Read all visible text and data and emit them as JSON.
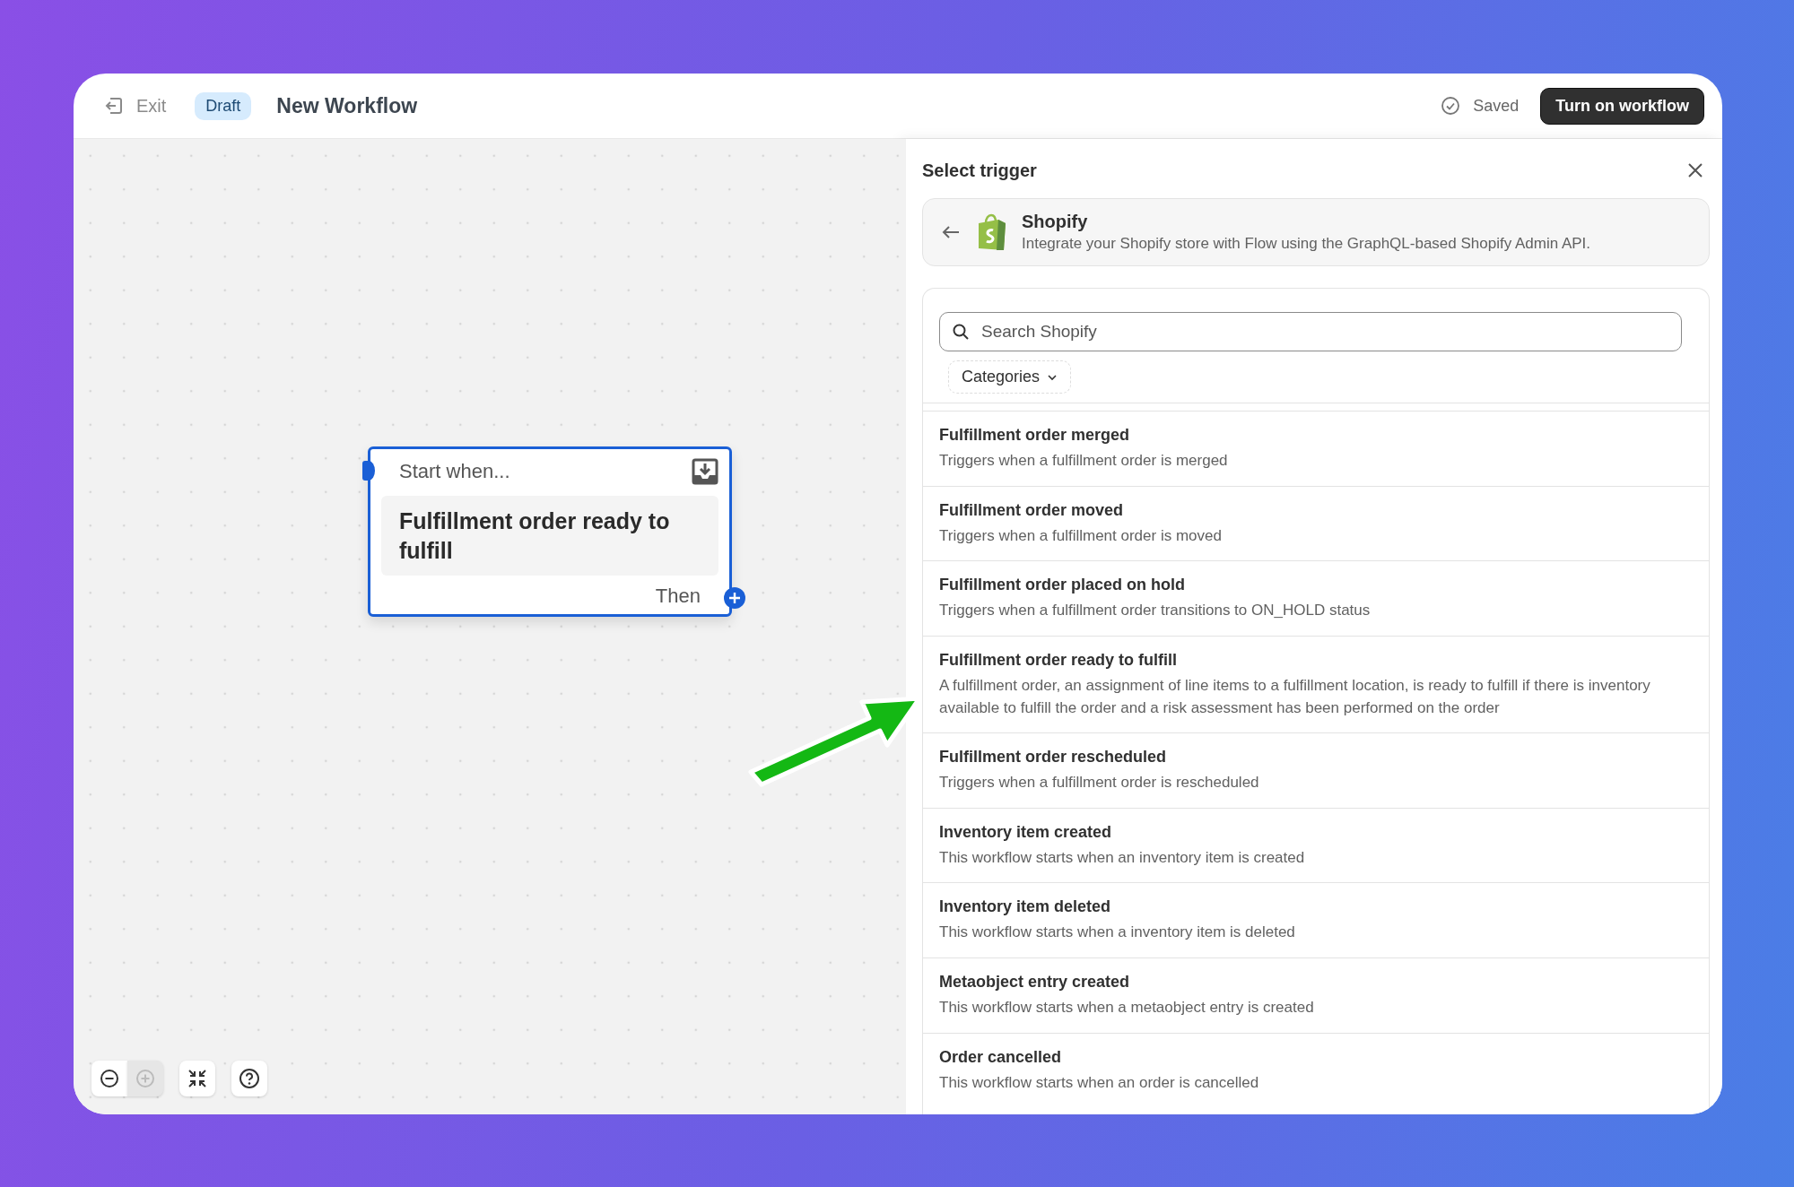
{
  "top_bar": {
    "exit": "Exit",
    "badge": "Draft",
    "title": "New Workflow",
    "saved": "Saved",
    "primary_button": "Turn on workflow"
  },
  "canvas": {
    "node": {
      "header": "Start when...",
      "title": "Fulfillment order ready to fulfill",
      "footer": "Then"
    },
    "controls": [
      {
        "kind": "zoom-out",
        "disabled": false
      },
      {
        "kind": "zoom-in",
        "disabled": true
      },
      {
        "kind": "fit",
        "disabled": false
      },
      {
        "kind": "help",
        "disabled": false
      }
    ]
  },
  "panel": {
    "title": "Select trigger",
    "app": {
      "name": "Shopify",
      "description": "Integrate your Shopify store with Flow using the GraphQL-based Shopify Admin API."
    },
    "search": {
      "placeholder": "Search Shopify"
    },
    "filter": "Categories",
    "triggers": [
      {
        "title": "Fulfillment order merged",
        "description": "Triggers when a fulfillment order is merged"
      },
      {
        "title": "Fulfillment order moved",
        "description": "Triggers when a fulfillment order is moved"
      },
      {
        "title": "Fulfillment order placed on hold",
        "description": "Triggers when a fulfillment order transitions to ON_HOLD status"
      },
      {
        "title": "Fulfillment order ready to fulfill",
        "description": "A fulfillment order, an assignment of line items to a fulfillment location, is ready to fulfill if there is inventory available to fulfill the order and a risk assessment has been performed on the order"
      },
      {
        "title": "Fulfillment order rescheduled",
        "description": "Triggers when a fulfillment order is rescheduled"
      },
      {
        "title": "Inventory item created",
        "description": "This workflow starts when an inventory item is created"
      },
      {
        "title": "Inventory item deleted",
        "description": "This workflow starts when a inventory item is deleted"
      },
      {
        "title": "Metaobject entry created",
        "description": "This workflow starts when a metaobject entry is created"
      },
      {
        "title": "Order cancelled",
        "description": "This workflow starts when an order is cancelled"
      }
    ]
  }
}
